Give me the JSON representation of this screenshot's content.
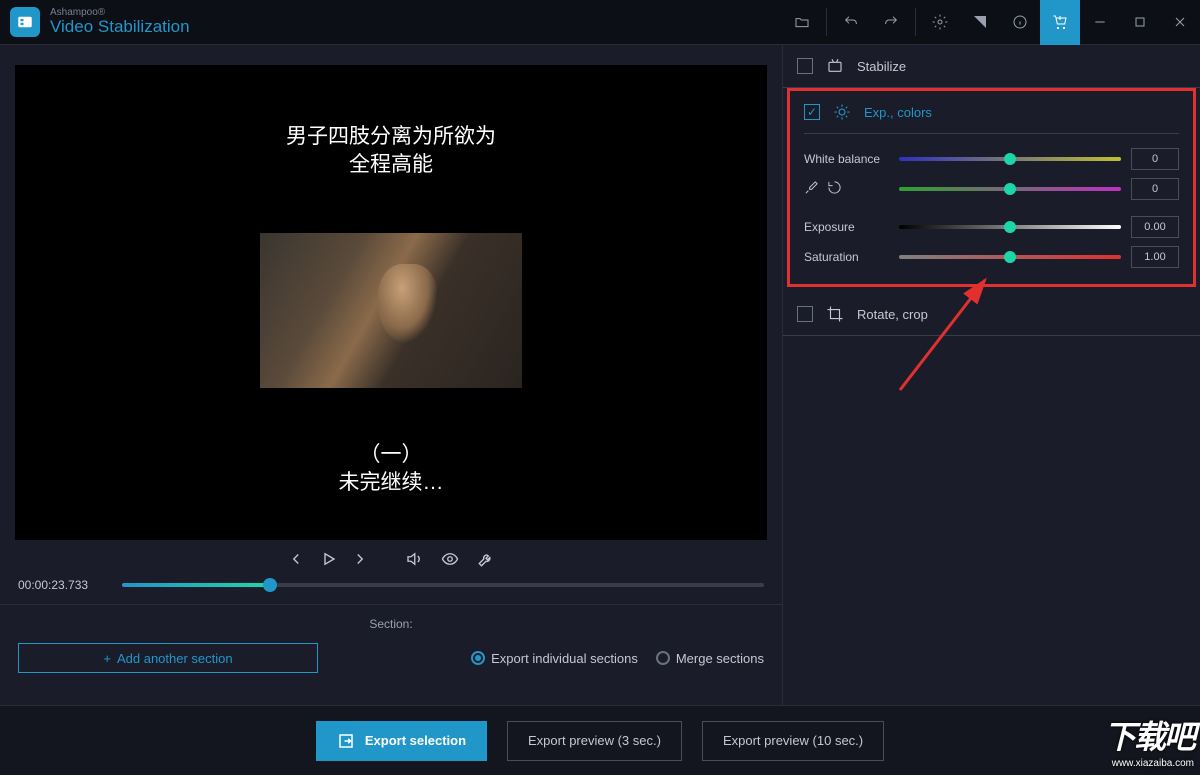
{
  "app": {
    "brand": "Ashampoo®",
    "product": "Video Stabilization"
  },
  "video_overlay": {
    "top_line1": "男子四肢分离为所欲为",
    "top_line2": "全程高能",
    "bottom_line1": "（一）",
    "bottom_line2": "未完继续…"
  },
  "timeline": {
    "timecode": "00:00:23.733",
    "progress_pct": 23
  },
  "section": {
    "label": "Section:",
    "add_label": "Add another section",
    "export_individual": "Export individual sections",
    "merge": "Merge sections",
    "selected": "individual"
  },
  "panels": {
    "stabilize": {
      "label": "Stabilize",
      "checked": false
    },
    "exp_colors": {
      "label": "Exp., colors",
      "checked": true,
      "white_balance_label": "White balance",
      "exposure_label": "Exposure",
      "saturation_label": "Saturation",
      "wb1_value": "0",
      "wb2_value": "0",
      "exposure_value": "0.00",
      "saturation_value": "1.00"
    },
    "rotate_crop": {
      "label": "Rotate, crop",
      "checked": false
    }
  },
  "export": {
    "selection": "Export selection",
    "preview3": "Export preview (3 sec.)",
    "preview10": "Export preview (10 sec.)"
  },
  "watermark": {
    "big": "下载吧",
    "url": "www.xiazaiba.com"
  }
}
